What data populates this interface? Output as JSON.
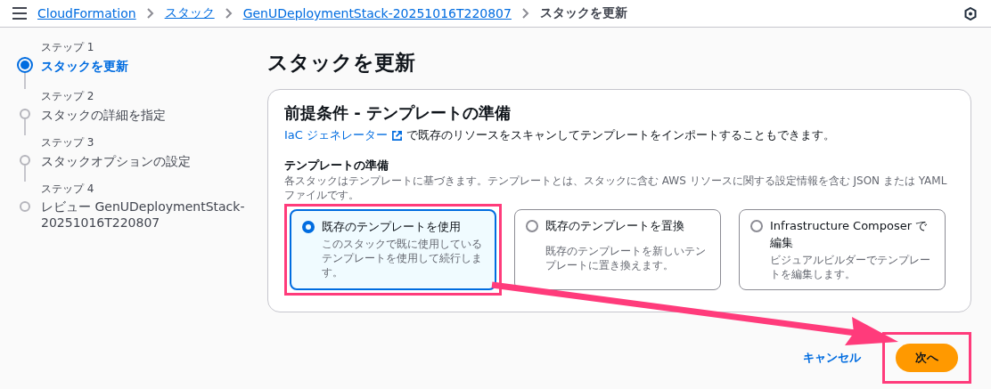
{
  "breadcrumb": [
    {
      "label": "CloudFormation",
      "link": true
    },
    {
      "label": "スタック",
      "link": true
    },
    {
      "label": "GenUDeploymentStack-20251016T220807",
      "link": true
    },
    {
      "label": "スタックを更新",
      "link": false
    }
  ],
  "steps": [
    {
      "label": "ステップ 1",
      "title": "スタックを更新",
      "selected": true
    },
    {
      "label": "ステップ 2",
      "title": "スタックの詳細を指定",
      "selected": false
    },
    {
      "label": "ステップ 3",
      "title": "スタックオプションの設定",
      "selected": false
    },
    {
      "label": "ステップ 4",
      "title": "レビュー GenUDeploymentStack-20251016T220807",
      "selected": false
    }
  ],
  "page_title": "スタックを更新",
  "card": {
    "title": "前提条件 - テンプレートの準備",
    "link": "IaC ジェネレーター",
    "text": "で既存のリソースをスキャンしてテンプレートをインポートすることもできます。",
    "field_label": "テンプレートの準備",
    "field_description": "各スタックはテンプレートに基づきます。テンプレートとは、スタックに含む AWS リソースに関する設定情報を含む JSON または YAML ファイルです。",
    "options": [
      {
        "title": "既存のテンプレートを使用",
        "description": "このスタックで既に使用しているテンプレートを使用して続行します。",
        "selected": true
      },
      {
        "title": "既存のテンプレートを置換",
        "description": "既存のテンプレートを新しいテンプレートに置き換えます。",
        "selected": false
      },
      {
        "title": "Infrastructure Composer で編集",
        "description": "ビジュアルビルダーでテンプレートを編集します。",
        "selected": false
      }
    ]
  },
  "actions": {
    "cancel": "キャンセル",
    "next": "次へ"
  }
}
